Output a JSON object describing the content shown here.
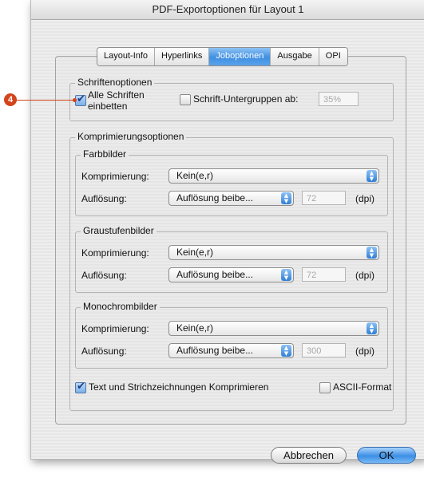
{
  "window": {
    "title": "PDF-Exportoptionen für Layout 1"
  },
  "tabs": [
    {
      "label": "Layout-Info",
      "active": false
    },
    {
      "label": "Hyperlinks",
      "active": false
    },
    {
      "label": "Joboptionen",
      "active": true
    },
    {
      "label": "Ausgabe",
      "active": false
    },
    {
      "label": "OPI",
      "active": false
    }
  ],
  "callout": {
    "number": "4",
    "color": "#d4441b"
  },
  "fonts": {
    "title": "Schriftenoptionen",
    "embed_all": {
      "label": "Alle Schriften einbetten",
      "line1": "Alle Schriften",
      "line2": "einbetten",
      "checked": true
    },
    "subset": {
      "label": "Schrift-Untergruppen ab:",
      "checked": false,
      "value": "35%"
    }
  },
  "compression": {
    "title": "Komprimierungsoptionen",
    "color": {
      "title": "Farbbilder",
      "compression_label": "Komprimierung:",
      "compression_value": "Kein(e,r)",
      "resolution_label": "Auflösung:",
      "resolution_value": "Auflösung beibe...",
      "dpi_value": "72",
      "dpi_unit": "(dpi)"
    },
    "grayscale": {
      "title": "Graustufenbilder",
      "compression_label": "Komprimierung:",
      "compression_value": "Kein(e,r)",
      "resolution_label": "Auflösung:",
      "resolution_value": "Auflösung beibe...",
      "dpi_value": "72",
      "dpi_unit": "(dpi)"
    },
    "mono": {
      "title": "Monochrombilder",
      "compression_label": "Komprimierung:",
      "compression_value": "Kein(e,r)",
      "resolution_label": "Auflösung:",
      "resolution_value": "Auflösung beibe...",
      "dpi_value": "300",
      "dpi_unit": "(dpi)"
    }
  },
  "options": {
    "compress_text": {
      "label": "Text und Strichzeichnungen Komprimieren",
      "checked": true
    },
    "ascii": {
      "label": "ASCII-Format",
      "checked": false
    }
  },
  "buttons": {
    "cancel": "Abbrechen",
    "ok": "OK"
  },
  "colors": {
    "accent": "#3f8fe0",
    "callout": "#d4441b"
  },
  "icons": {
    "select_arrows": "updown-arrows-icon",
    "check": "checkmark-icon"
  }
}
